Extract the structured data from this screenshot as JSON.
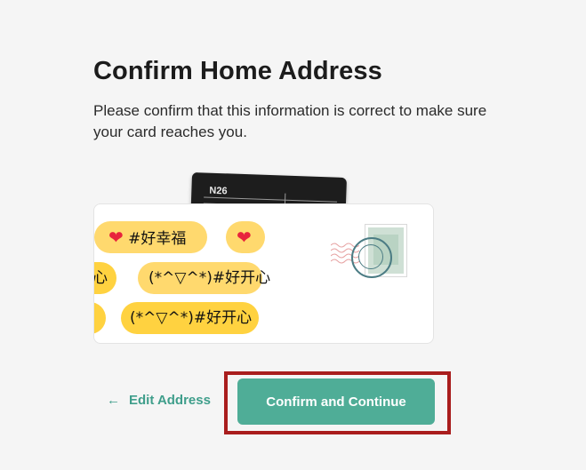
{
  "page": {
    "title": "Confirm Home Address",
    "subtitle": "Please confirm that this information is correct to make sure your card reaches you."
  },
  "card": {
    "logo": "N26"
  },
  "envelope": {
    "bubbles": [
      "#好幸福",
      "心",
      "(*^▽^*)#好开心",
      "(*^▽^*)#好开心"
    ]
  },
  "actions": {
    "edit_label": "Edit Address",
    "confirm_label": "Confirm and Continue"
  },
  "colors": {
    "accent": "#4fad97",
    "link": "#3f9e8b",
    "highlight": "#a91d1d",
    "bubble": "#ffd96e"
  },
  "icons": {
    "edit": "arrow-left-icon",
    "heart": "heart-icon"
  }
}
